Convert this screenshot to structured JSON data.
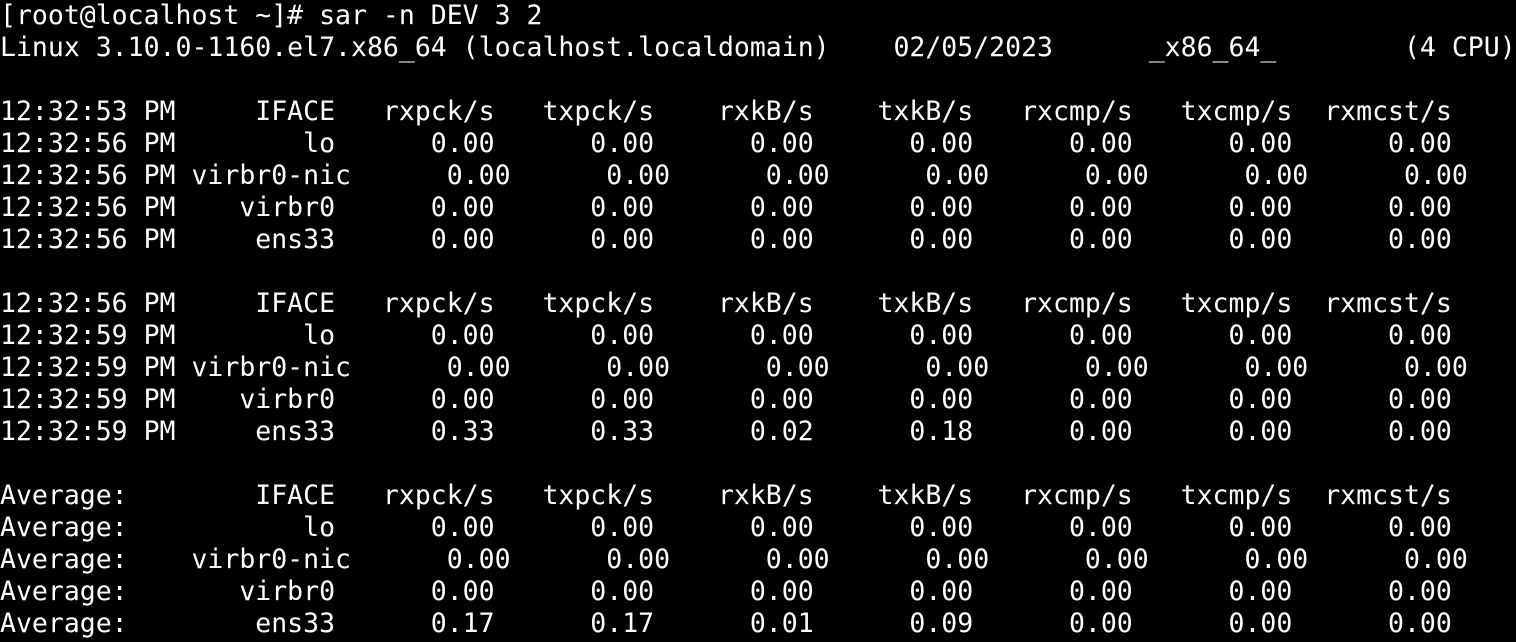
{
  "terminal": {
    "prompt": "[root@localhost ~]# ",
    "command": "sar -n DEV 3 2",
    "sysinfo": "Linux 3.10.0-1160.el7.x86_64 (localhost.localdomain)    02/05/2023      _x86_64_        (4 CPU)",
    "colors": {
      "background": "#000000",
      "foreground": "#ffffff"
    }
  },
  "blocks": [
    {
      "header": "12:32:53 PM     IFACE   rxpck/s   txpck/s    rxkB/s    txkB/s   rxcmp/s   txcmp/s  rxmcst/s",
      "rows": [
        "12:32:56 PM        lo      0.00      0.00      0.00      0.00      0.00      0.00      0.00",
        "12:32:56 PM virbr0-nic      0.00      0.00      0.00      0.00      0.00      0.00      0.00",
        "12:32:56 PM    virbr0      0.00      0.00      0.00      0.00      0.00      0.00      0.00",
        "12:32:56 PM     ens33      0.00      0.00      0.00      0.00      0.00      0.00      0.00"
      ]
    },
    {
      "header": "12:32:56 PM     IFACE   rxpck/s   txpck/s    rxkB/s    txkB/s   rxcmp/s   txcmp/s  rxmcst/s",
      "rows": [
        "12:32:59 PM        lo      0.00      0.00      0.00      0.00      0.00      0.00      0.00",
        "12:32:59 PM virbr0-nic      0.00      0.00      0.00      0.00      0.00      0.00      0.00",
        "12:32:59 PM    virbr0      0.00      0.00      0.00      0.00      0.00      0.00      0.00",
        "12:32:59 PM     ens33      0.33      0.33      0.02      0.18      0.00      0.00      0.00"
      ]
    },
    {
      "header": "Average:        IFACE   rxpck/s   txpck/s    rxkB/s    txkB/s   rxcmp/s   txcmp/s  rxmcst/s",
      "rows": [
        "Average:           lo      0.00      0.00      0.00      0.00      0.00      0.00      0.00",
        "Average:    virbr0-nic      0.00      0.00      0.00      0.00      0.00      0.00      0.00",
        "Average:       virbr0      0.00      0.00      0.00      0.00      0.00      0.00      0.00",
        "Average:        ens33      0.17      0.17      0.01      0.09      0.00      0.00      0.00"
      ]
    }
  ]
}
